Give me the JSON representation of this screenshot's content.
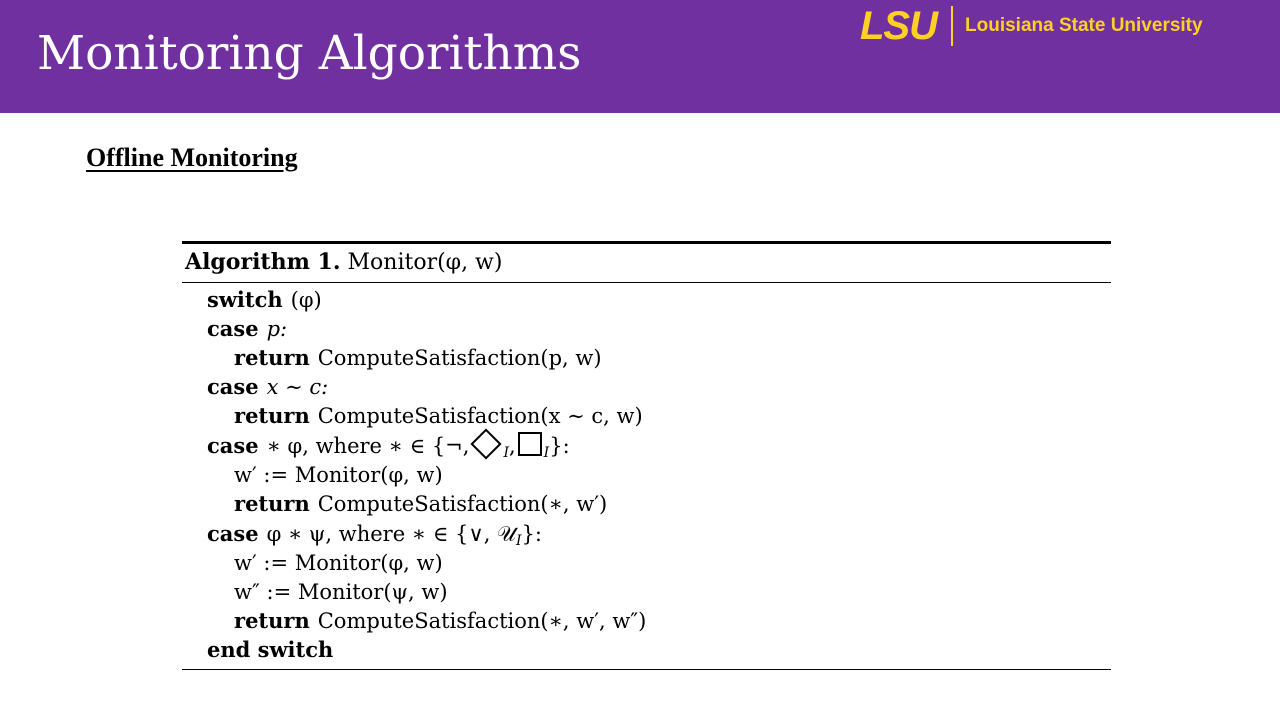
{
  "header": {
    "title": "Monitoring Algorithms",
    "brand_mark": "LSU",
    "brand_name": "Louisiana State University",
    "colors": {
      "background": "#7030a0",
      "brand": "#fdd023",
      "title": "#ffffff"
    }
  },
  "section": {
    "title": "Offline Monitoring"
  },
  "algorithm": {
    "label": "Algorithm 1.",
    "signature": "Monitor(φ, w)",
    "lines": [
      {
        "keyword": "switch",
        "text": "(φ)"
      },
      {
        "keyword": "case",
        "text": "p:"
      },
      {
        "keyword": "return",
        "text": "ComputeSatisfaction(p, w)"
      },
      {
        "keyword": "case",
        "text": "x ∼ c:"
      },
      {
        "keyword": "return",
        "text": "ComputeSatisfaction(x ∼ c, w)"
      },
      {
        "keyword": "case",
        "text_before": "∗ φ, where ∗ ∈ {¬,",
        "sub1": "I",
        "sub2": "I",
        "text_after": "}:"
      },
      {
        "keyword": "",
        "text": "w′ := Monitor(φ, w)"
      },
      {
        "keyword": "return",
        "text": "ComputeSatisfaction(∗, w′)"
      },
      {
        "keyword": "case",
        "text_before": "φ  ∗  ψ, where ∗ ∈ {∨, 𝒰",
        "sub": "I",
        "text_after": "}:"
      },
      {
        "keyword": "",
        "text": "w′ := Monitor(φ, w)"
      },
      {
        "keyword": "",
        "text": "w″ := Monitor(ψ, w)"
      },
      {
        "keyword": "return",
        "text": "ComputeSatisfaction(∗, w′, w″)"
      },
      {
        "keyword": "end switch",
        "text": ""
      }
    ]
  }
}
